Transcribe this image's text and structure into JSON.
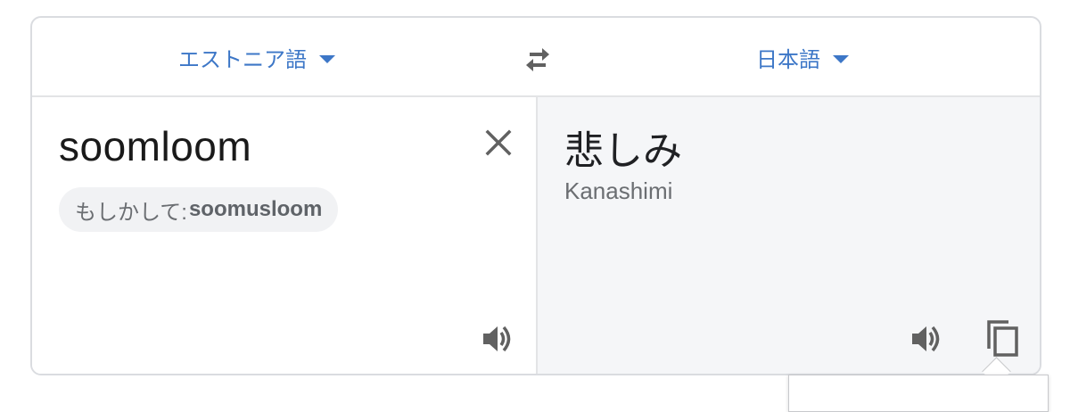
{
  "language_bar": {
    "source_language": "エストニア語",
    "target_language": "日本語"
  },
  "source": {
    "text": "soomloom",
    "suggestion_prefix": "もしかして:",
    "suggestion_word": "soomusloom"
  },
  "target": {
    "text": "悲しみ",
    "romanization": "Kanashimi"
  },
  "icons": {
    "dropdown": "caret-down-icon",
    "swap": "swap-arrows-icon",
    "clear": "close-icon",
    "listen": "speaker-icon",
    "copy": "copy-icon"
  },
  "colors": {
    "accent": "#3d77c7",
    "border": "#dadce0",
    "target_pane_bg": "#f5f6f8",
    "icon": "#616161"
  }
}
